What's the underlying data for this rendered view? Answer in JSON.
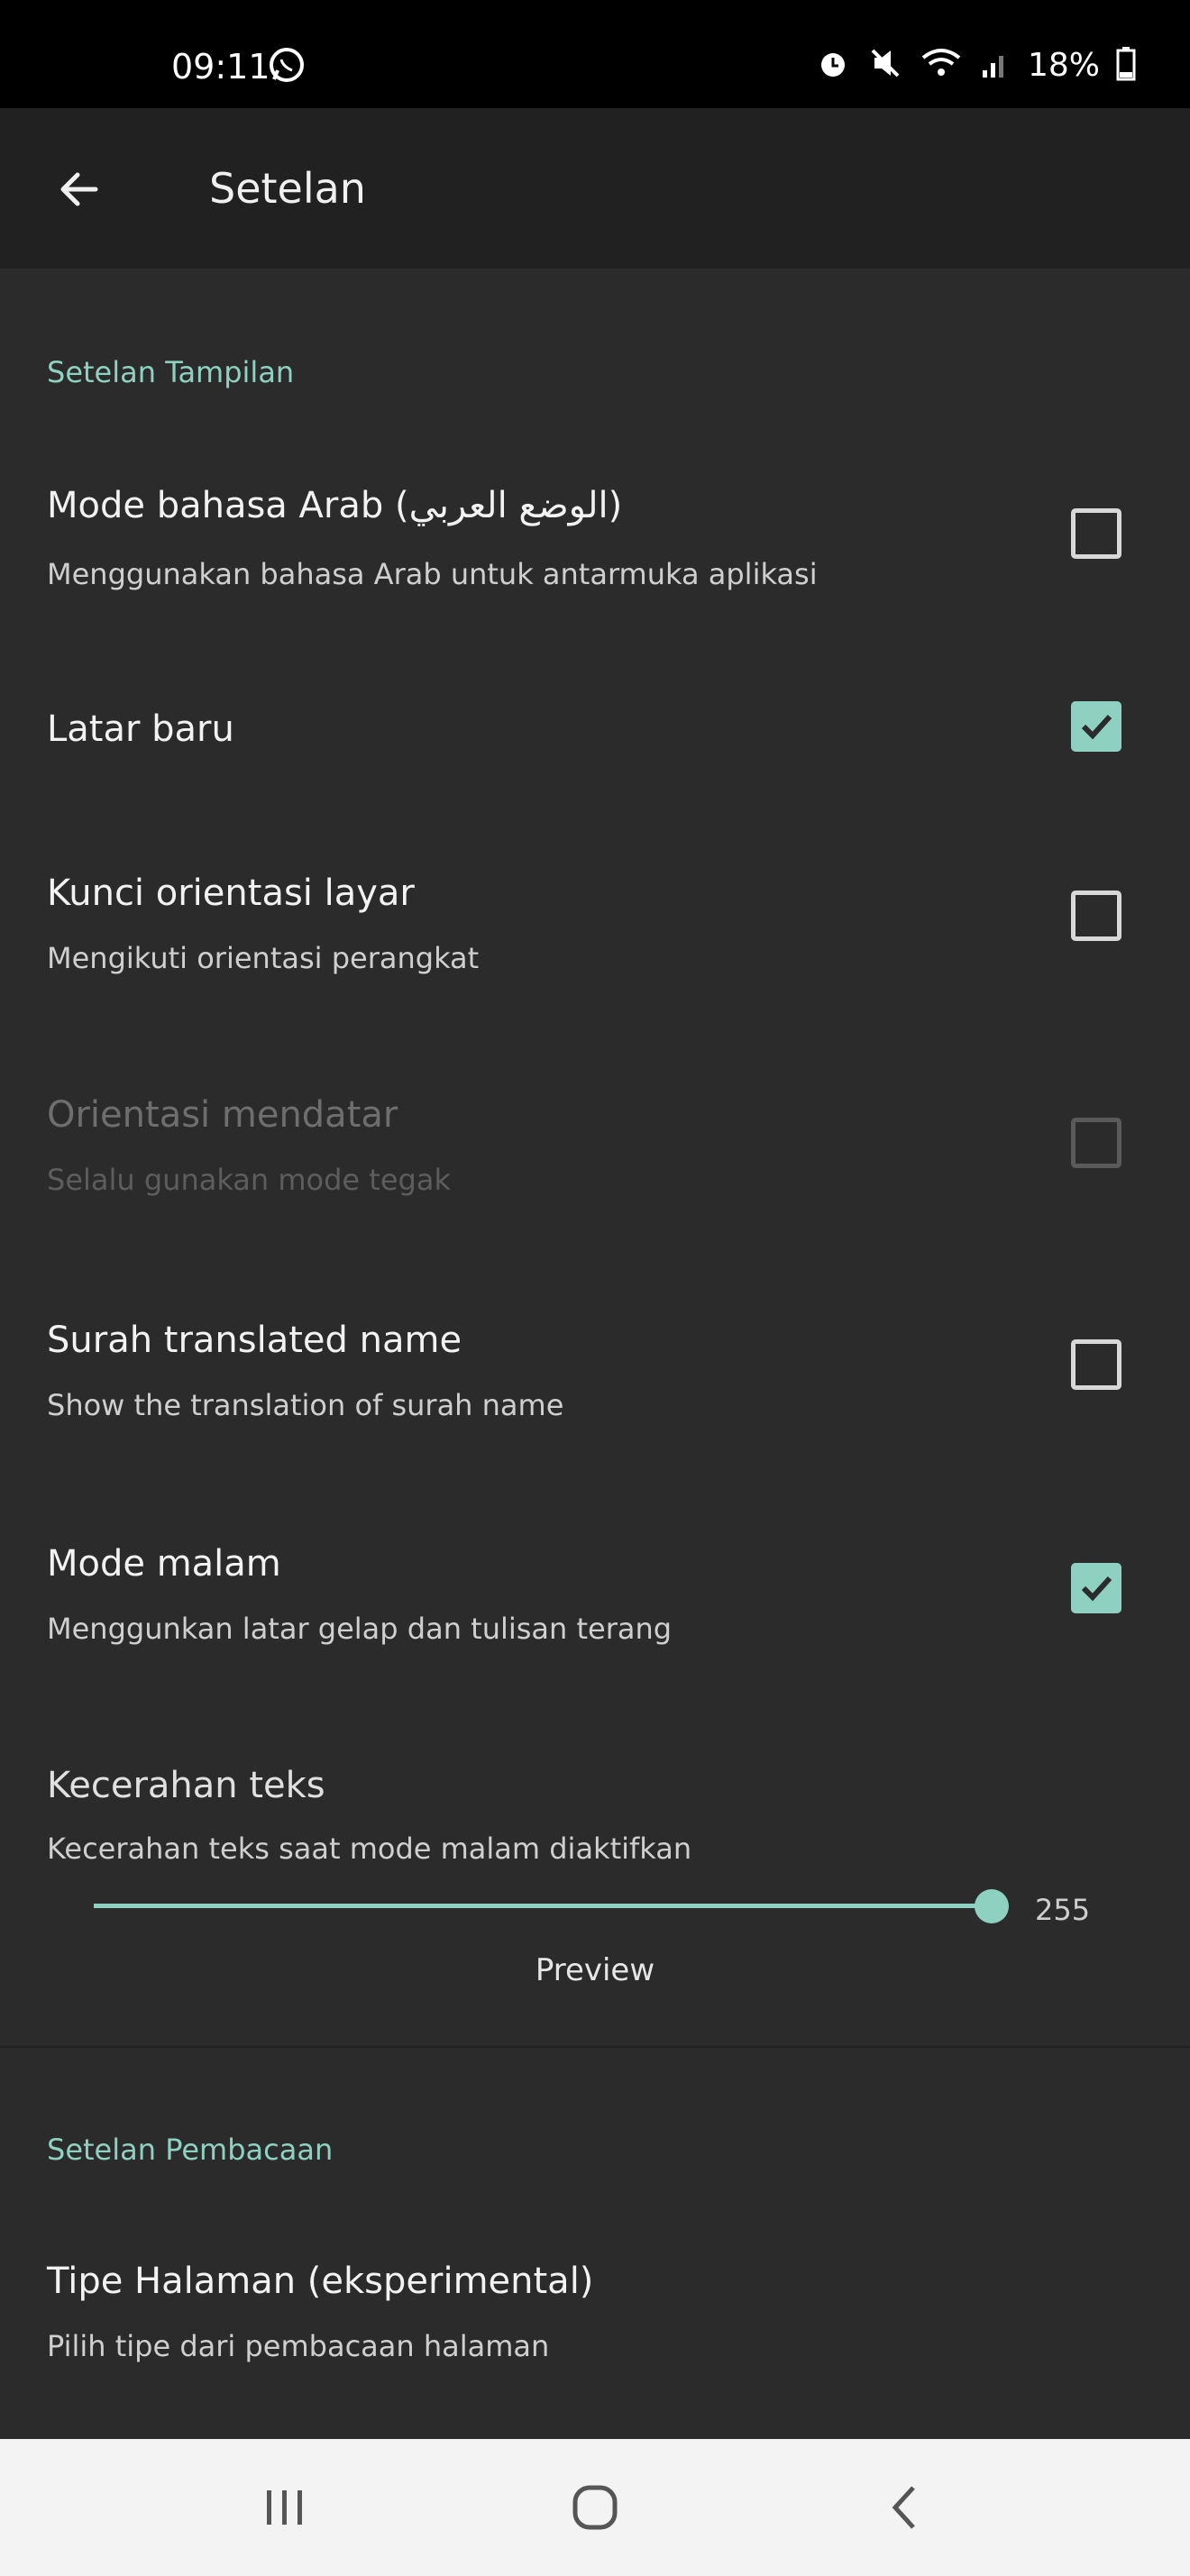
{
  "status_bar": {
    "time": "09:11",
    "battery": "18%",
    "icons": [
      "whatsapp-icon",
      "alarm-icon",
      "mute-icon",
      "wifi-icon",
      "signal-icon",
      "battery-icon"
    ]
  },
  "app_bar": {
    "title": "Setelan",
    "back_icon": "arrow-left-icon"
  },
  "display_section": {
    "header": "Setelan Tampilan",
    "items": [
      {
        "title": "Mode bahasa Arab (الوضع العربي)",
        "summary": "Menggunakan bahasa Arab untuk antarmuka aplikasi",
        "checked": false,
        "enabled": true
      },
      {
        "title": "Latar baru",
        "summary": "",
        "checked": true,
        "enabled": true
      },
      {
        "title": "Kunci orientasi layar",
        "summary": "Mengikuti orientasi perangkat",
        "checked": false,
        "enabled": true
      },
      {
        "title": "Orientasi mendatar",
        "summary": "Selalu gunakan mode tegak",
        "checked": false,
        "enabled": false
      },
      {
        "title": "Surah translated name",
        "summary": "Show the translation of surah name",
        "checked": false,
        "enabled": true
      },
      {
        "title": "Mode malam",
        "summary": "Menggunkan latar gelap dan tulisan terang",
        "checked": true,
        "enabled": true
      }
    ],
    "brightness": {
      "title": "Kecerahan teks",
      "summary": "Kecerahan teks saat mode malam diaktifkan",
      "value": "255",
      "fraction": 1.0,
      "preview_label": "Preview"
    }
  },
  "reading_section": {
    "header": "Setelan Pembacaan",
    "items": [
      {
        "title": "Tipe Halaman (eksperimental)",
        "summary": "Pilih tipe dari pembacaan halaman"
      }
    ]
  },
  "nav_bar": {
    "buttons": [
      "recents-icon",
      "home-icon",
      "back-icon"
    ]
  },
  "colors": {
    "accent": "#8fd1c0",
    "background": "#2b2b2b",
    "app_bar": "#212121"
  }
}
